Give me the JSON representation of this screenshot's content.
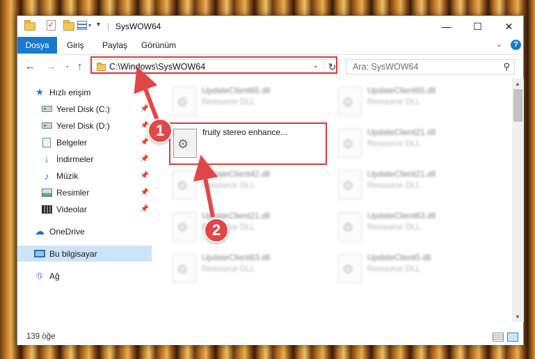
{
  "window": {
    "title": "SysWOW64",
    "controls": {
      "minimize": "—",
      "maximize": "☐",
      "close": "✕"
    }
  },
  "ribbon": {
    "tabs": [
      {
        "label": "Dosya",
        "active": true
      },
      {
        "label": "Giriş"
      },
      {
        "label": "Paylaş"
      },
      {
        "label": "Görünüm"
      }
    ],
    "expand_icon": "chevron-down-icon",
    "help_label": "?"
  },
  "nav": {
    "address": "C:\\Windows\\SysWOW64",
    "search_placeholder": "Ara: SysWOW64"
  },
  "sidebar": {
    "items": [
      {
        "label": "Hızlı erişim",
        "icon": "star-icon"
      },
      {
        "label": "Yerel Disk (C:)",
        "icon": "drive-icon",
        "pinned": true
      },
      {
        "label": "Yerel Disk (D:)",
        "icon": "drive-icon",
        "pinned": true
      },
      {
        "label": "Belgeler",
        "icon": "document-icon",
        "pinned": true
      },
      {
        "label": "İndirmeler",
        "icon": "download-icon",
        "pinned": true
      },
      {
        "label": "Müzik",
        "icon": "music-icon",
        "pinned": true
      },
      {
        "label": "Resimler",
        "icon": "picture-icon",
        "pinned": true
      },
      {
        "label": "Videolar",
        "icon": "video-icon",
        "pinned": true
      },
      {
        "label": "OneDrive",
        "icon": "cloud-icon"
      },
      {
        "label": "Bu bilgisayar",
        "icon": "computer-icon",
        "selected": true
      },
      {
        "label": "Ağ",
        "icon": "network-icon"
      }
    ]
  },
  "files": {
    "left": [
      {
        "name": "UpdateClient65.dll",
        "type": "Resource DLL"
      },
      {
        "name": "fruity stereo enhance...",
        "type": ""
      },
      {
        "name": "UpdateClient42.dll",
        "type": "Resource DLL"
      },
      {
        "name": "UpdateClient21.dll",
        "type": "Resource DLL"
      },
      {
        "name": "UpdateClient63.dll",
        "type": "Resource DLL"
      }
    ],
    "right": [
      {
        "name": "UpdateClient65.dll",
        "type": "Resource DLL"
      },
      {
        "name": "UpdateClient21.dll",
        "type": "Resource DLL"
      },
      {
        "name": "UpdateClient21.dll",
        "type": "Resource DLL"
      },
      {
        "name": "UpdateClient63.dll",
        "type": "Resource DLL"
      },
      {
        "name": "UpdateClient5.dll",
        "type": "Resource DLL"
      }
    ]
  },
  "status": {
    "item_count": "139 öğe"
  },
  "annotations": {
    "callout_1": "1",
    "callout_2": "2"
  },
  "colors": {
    "highlight": "#d83a3a",
    "accent": "#1979ca",
    "selection": "#cce4f7"
  }
}
